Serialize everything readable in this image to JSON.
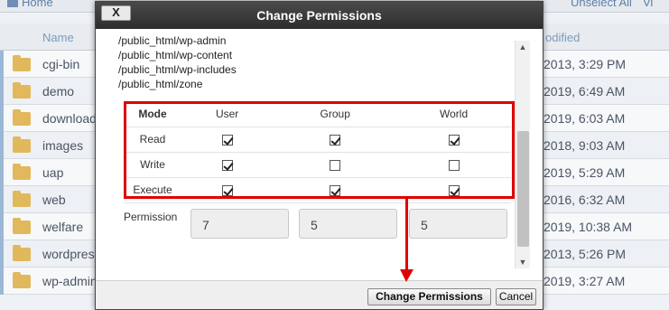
{
  "background": {
    "toolbar": {
      "home_label": "Home",
      "unselect_label": "Unselect All",
      "view_label": "Vi"
    },
    "columns": {
      "name": "Name",
      "modified": "odified"
    },
    "files": [
      {
        "name": "cgi-bin",
        "date": "2013, 3:29 PM"
      },
      {
        "name": "demo",
        "date": "2019, 6:49 AM"
      },
      {
        "name": "download",
        "date": "2019, 6:03 AM"
      },
      {
        "name": "images",
        "date": "2018, 9:03 AM"
      },
      {
        "name": "uap",
        "date": "2019, 5:29 AM"
      },
      {
        "name": "web",
        "date": "2016, 6:32 AM"
      },
      {
        "name": "welfare",
        "date": "2019, 10:38 AM"
      },
      {
        "name": "wordpres",
        "date": "2013, 5:26 PM"
      },
      {
        "name": "wp-admin",
        "date": "2019, 3:27 AM"
      }
    ]
  },
  "dialog": {
    "title": "Change Permissions",
    "close_label": "X",
    "paths": [
      "/public_html/wp-admin",
      "/public_html/wp-content",
      "/public_html/wp-includes",
      "/public_html/zone"
    ],
    "table": {
      "headers": [
        "Mode",
        "User",
        "Group",
        "World"
      ],
      "rows": [
        {
          "label": "Read",
          "user": true,
          "group": true,
          "world": true
        },
        {
          "label": "Write",
          "user": true,
          "group": false,
          "world": false
        },
        {
          "label": "Execute",
          "user": true,
          "group": true,
          "world": true
        }
      ]
    },
    "permission_label": "Permission",
    "permission_values": {
      "user": "7",
      "group": "5",
      "world": "5"
    },
    "change_button": "Change Permissions",
    "cancel_button": "Cancel"
  },
  "annotation_color": "#e00000"
}
